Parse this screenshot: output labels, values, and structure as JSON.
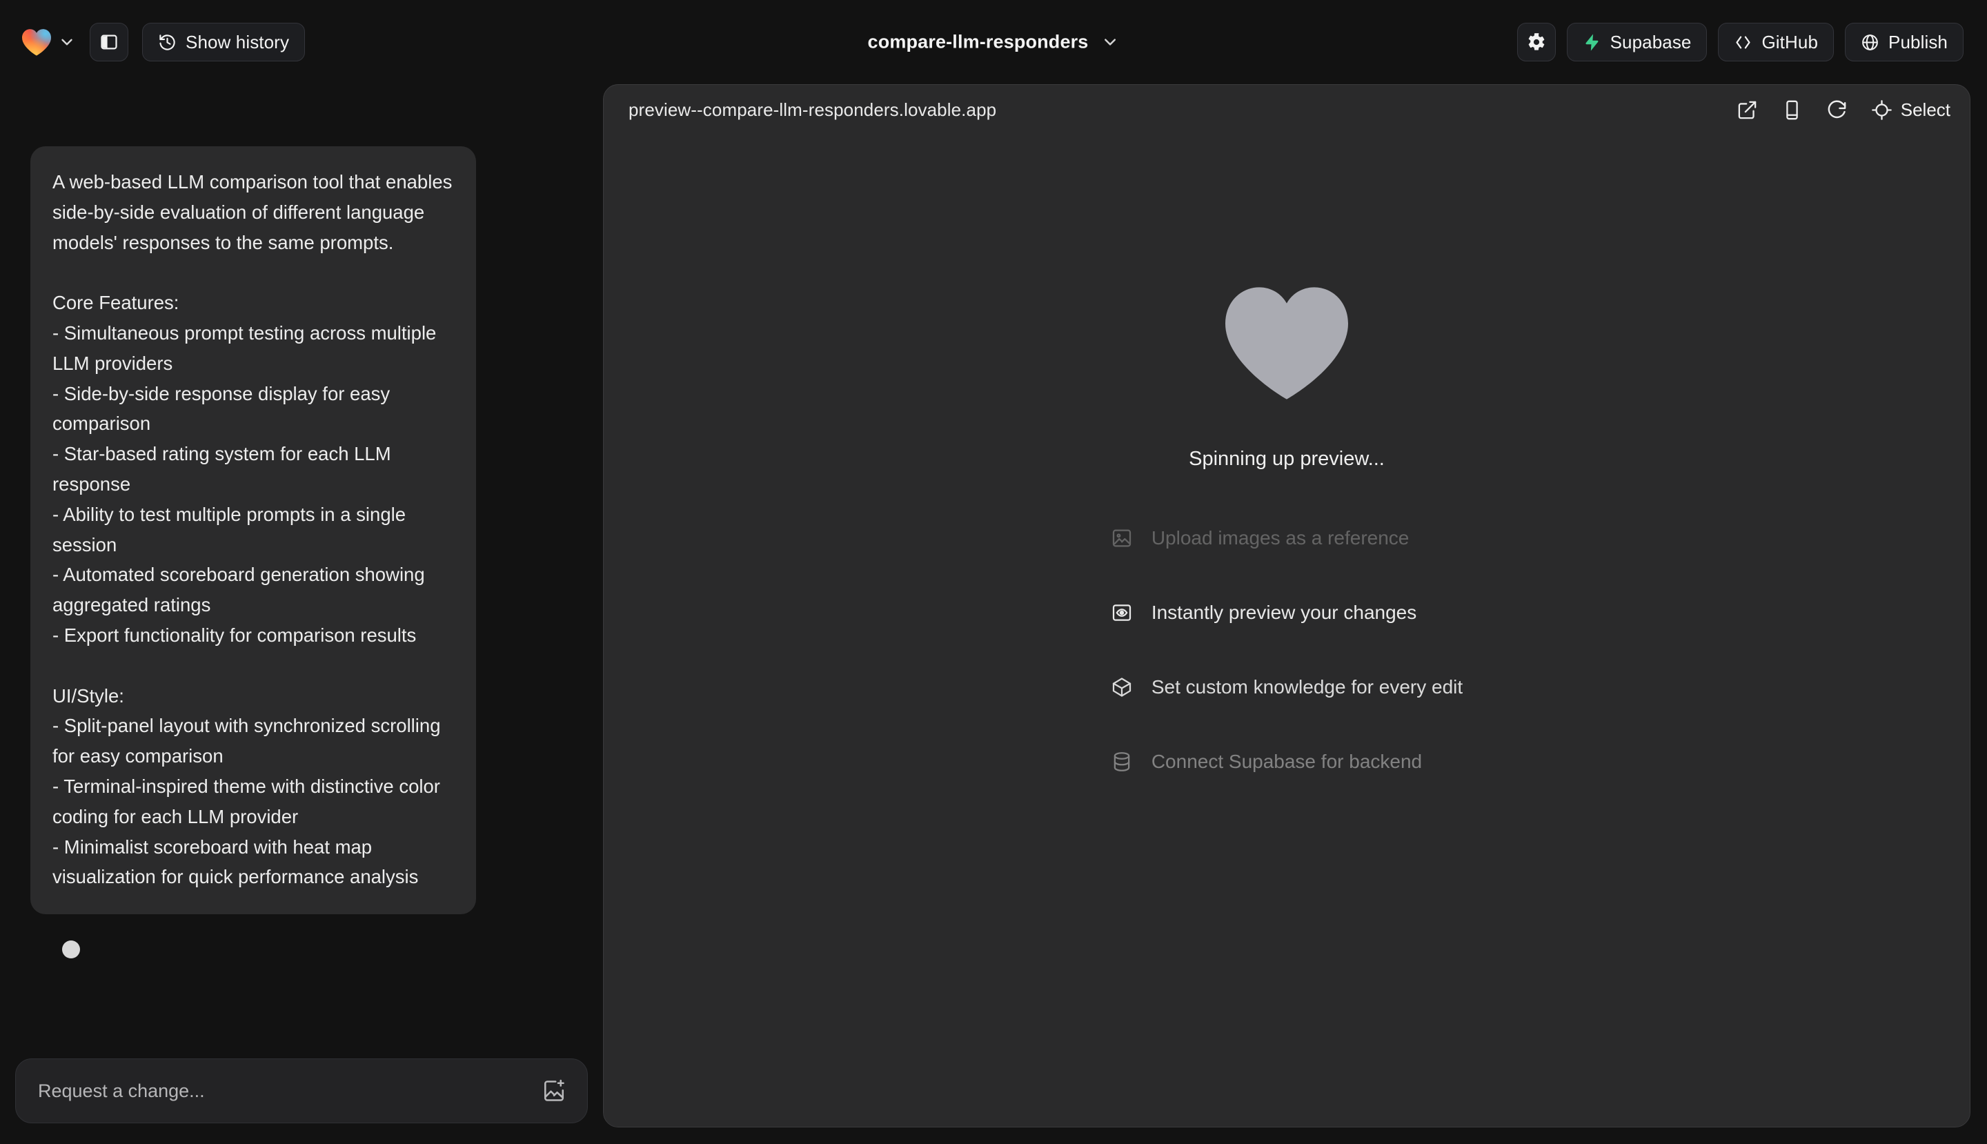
{
  "topbar": {
    "logo_icon": "lovable-heart-logo",
    "logo_chevron_icon": "chevron-down-icon",
    "sidebar_toggle_icon": "panel-left-icon",
    "history_button": {
      "label": "Show history",
      "icon": "history-clock-icon"
    },
    "project_title": "compare-llm-responders",
    "project_chevron_icon": "chevron-down-icon",
    "settings_icon": "gear-icon",
    "supabase_button": {
      "label": "Supabase",
      "icon": "supabase-bolt-icon",
      "color": "#3ecf8e"
    },
    "github_button": {
      "label": "GitHub",
      "icon": "code-brackets-icon"
    },
    "publish_button": {
      "label": "Publish",
      "icon": "globe-icon"
    }
  },
  "chat": {
    "message": "A web-based LLM comparison tool that enables side-by-side evaluation of different language models' responses to the same prompts.\n\nCore Features:\n- Simultaneous prompt testing across multiple LLM providers\n- Side-by-side response display for easy comparison\n- Star-based rating system for each LLM response\n- Ability to test multiple prompts in a single session\n- Automated scoreboard generation showing aggregated ratings\n- Export functionality for comparison results\n\nUI/Style:\n- Split-panel layout with synchronized scrolling for easy comparison\n- Terminal-inspired theme with distinctive color coding for each LLM provider\n- Minimalist scoreboard with heat map visualization for quick performance analysis",
    "loading_indicator": "loading-dot",
    "composer": {
      "placeholder": "Request a change...",
      "value": "",
      "attach_icon": "add-image-icon"
    }
  },
  "preview": {
    "url": "preview--compare-llm-responders.lovable.app",
    "actions": {
      "open_external_icon": "external-link-icon",
      "device_icon": "mobile-device-icon",
      "refresh_icon": "refresh-icon",
      "select_icon": "crosshair-icon",
      "select_label": "Select"
    },
    "status_icon": "lovable-heart-gray",
    "status_text": "Spinning up preview...",
    "hints": [
      {
        "icon": "image-icon",
        "label": "Upload images as a reference"
      },
      {
        "icon": "eye-preview-icon",
        "label": "Instantly preview your changes"
      },
      {
        "icon": "knowledge-box-icon",
        "label": "Set custom knowledge for every edit"
      },
      {
        "icon": "database-icon",
        "label": "Connect Supabase for backend"
      }
    ]
  },
  "colors": {
    "app_bg": "#121212",
    "panel_bg": "#2a2a2b",
    "bubble_bg": "#2b2b2c",
    "supabase_green": "#3ecf8e",
    "heart_gray": "#aaabb2"
  }
}
